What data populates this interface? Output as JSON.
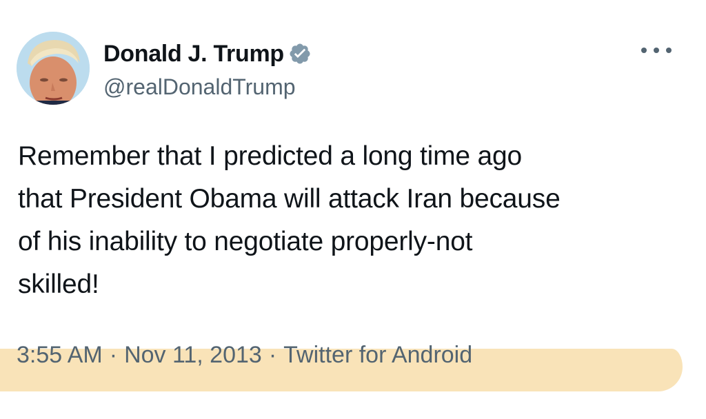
{
  "author": {
    "display_name": "Donald J. Trump",
    "handle": "@realDonaldTrump",
    "verified_icon": "verified-badge-icon"
  },
  "tweet": {
    "line1": "Remember that I predicted a long time ago",
    "line2": "that President Obama will attack Iran because",
    "line3": "of his inability to negotiate properly-not",
    "line4": "skilled!"
  },
  "meta": {
    "time": "3:55 AM",
    "separator": "·",
    "date": "Nov 11, 2013",
    "source": "Twitter for Android"
  },
  "colors": {
    "text": "#0f1419",
    "secondary": "#536471",
    "verified": "#829aab",
    "highlight": "#f9e2b4"
  }
}
